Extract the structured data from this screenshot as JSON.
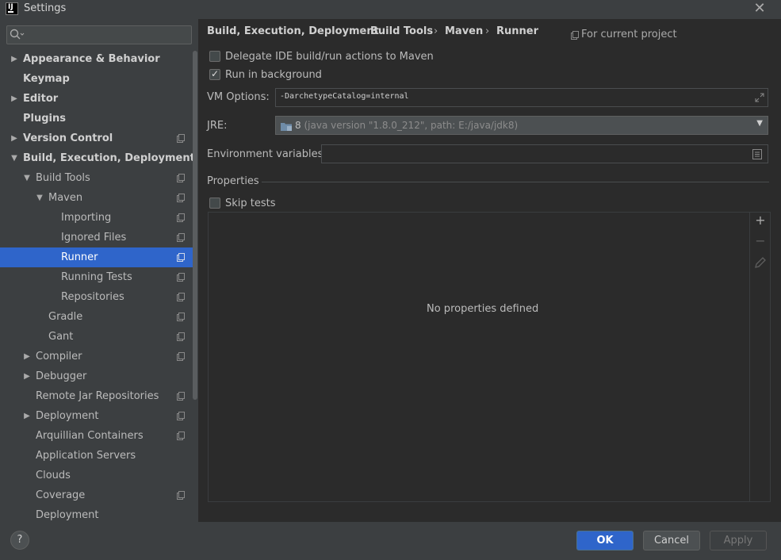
{
  "window": {
    "title": "Settings",
    "close": "✕"
  },
  "search": {
    "placeholder": ""
  },
  "tree": [
    {
      "label": "Appearance & Behavior",
      "arrow": "▶"
    },
    {
      "label": "Keymap",
      "arrow": ""
    },
    {
      "label": "Editor",
      "arrow": "▶"
    },
    {
      "label": "Plugins",
      "arrow": ""
    },
    {
      "label": "Version Control",
      "arrow": "▶"
    },
    {
      "label": "Build, Execution, Deployment",
      "arrow": "▼"
    },
    {
      "label": "Build Tools",
      "arrow": "▼"
    },
    {
      "label": "Maven",
      "arrow": "▼"
    },
    {
      "label": "Importing",
      "arrow": ""
    },
    {
      "label": "Ignored Files",
      "arrow": ""
    },
    {
      "label": "Runner",
      "arrow": ""
    },
    {
      "label": "Running Tests",
      "arrow": ""
    },
    {
      "label": "Repositories",
      "arrow": ""
    },
    {
      "label": "Gradle",
      "arrow": ""
    },
    {
      "label": "Gant",
      "arrow": ""
    },
    {
      "label": "Compiler",
      "arrow": "▶"
    },
    {
      "label": "Debugger",
      "arrow": "▶"
    },
    {
      "label": "Remote Jar Repositories",
      "arrow": ""
    },
    {
      "label": "Deployment",
      "arrow": "▶"
    },
    {
      "label": "Arquillian Containers",
      "arrow": ""
    },
    {
      "label": "Application Servers",
      "arrow": ""
    },
    {
      "label": "Clouds",
      "arrow": ""
    },
    {
      "label": "Coverage",
      "arrow": ""
    },
    {
      "label": "Deployment",
      "arrow": ""
    }
  ],
  "breadcrumb": {
    "items": [
      "Build, Execution, Deployment",
      "Build Tools",
      "Maven",
      "Runner"
    ],
    "separator": "›",
    "scope": "For current project"
  },
  "options": {
    "delegate_label": "Delegate IDE build/run actions to Maven",
    "delegate_checked": false,
    "background_label": "Run in background",
    "background_checked": true,
    "vm_label": "VM Options:",
    "vm_value": "-DarchetypeCatalog=internal",
    "jre_label": "JRE:",
    "jre_version": "8",
    "jre_detail": "(java version \"1.8.0_212\", path: E:/java/jdk8)",
    "env_label": "Environment variables:",
    "env_value": ""
  },
  "properties": {
    "title": "Properties",
    "skip_tests_label": "Skip tests",
    "skip_tests_checked": false,
    "empty_text": "No properties defined",
    "add": "+",
    "remove": "−"
  },
  "footer": {
    "help": "?",
    "ok": "OK",
    "cancel": "Cancel",
    "apply": "Apply"
  },
  "colors": {
    "selection": "#2f65ca",
    "panel": "#3c3f41",
    "background": "#2b2b2b"
  }
}
